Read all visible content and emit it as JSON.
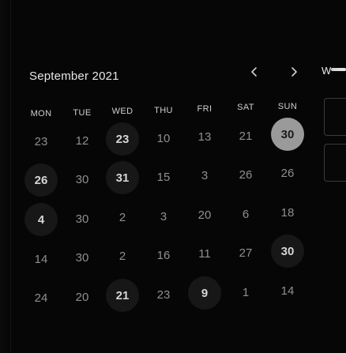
{
  "calendar": {
    "month_label": "September 2021",
    "prev_icon": "chevron-left-icon",
    "next_icon": "chevron-right-icon",
    "weekdays": [
      "MON",
      "TUE",
      "WED",
      "THU",
      "FRI",
      "SAT",
      "SUN"
    ],
    "rows": [
      [
        {
          "d": "23",
          "s": "plain"
        },
        {
          "d": "12",
          "s": "plain"
        },
        {
          "d": "23",
          "s": "bold"
        },
        {
          "d": "10",
          "s": "plain"
        },
        {
          "d": "13",
          "s": "plain"
        },
        {
          "d": "21",
          "s": "plain"
        },
        {
          "d": "30",
          "s": "selected"
        }
      ],
      [
        {
          "d": "26",
          "s": "bold"
        },
        {
          "d": "30",
          "s": "plain"
        },
        {
          "d": "31",
          "s": "bold"
        },
        {
          "d": "15",
          "s": "plain"
        },
        {
          "d": "3",
          "s": "plain"
        },
        {
          "d": "26",
          "s": "plain"
        },
        {
          "d": "26",
          "s": "plain"
        }
      ],
      [
        {
          "d": "4",
          "s": "bold"
        },
        {
          "d": "30",
          "s": "plain"
        },
        {
          "d": "2",
          "s": "plain"
        },
        {
          "d": "3",
          "s": "plain"
        },
        {
          "d": "20",
          "s": "plain"
        },
        {
          "d": "6",
          "s": "plain"
        },
        {
          "d": "18",
          "s": "plain"
        }
      ],
      [
        {
          "d": "14",
          "s": "plain"
        },
        {
          "d": "30",
          "s": "plain"
        },
        {
          "d": "2",
          "s": "plain"
        },
        {
          "d": "16",
          "s": "plain"
        },
        {
          "d": "11",
          "s": "plain"
        },
        {
          "d": "27",
          "s": "plain"
        },
        {
          "d": "30",
          "s": "bold"
        }
      ],
      [
        {
          "d": "24",
          "s": "plain"
        },
        {
          "d": "20",
          "s": "plain"
        },
        {
          "d": "21",
          "s": "bold"
        },
        {
          "d": "23",
          "s": "plain"
        },
        {
          "d": "9",
          "s": "bold"
        },
        {
          "d": "1",
          "s": "plain"
        },
        {
          "d": "14",
          "s": "plain"
        }
      ]
    ]
  },
  "side_panel": {
    "label": "W"
  }
}
